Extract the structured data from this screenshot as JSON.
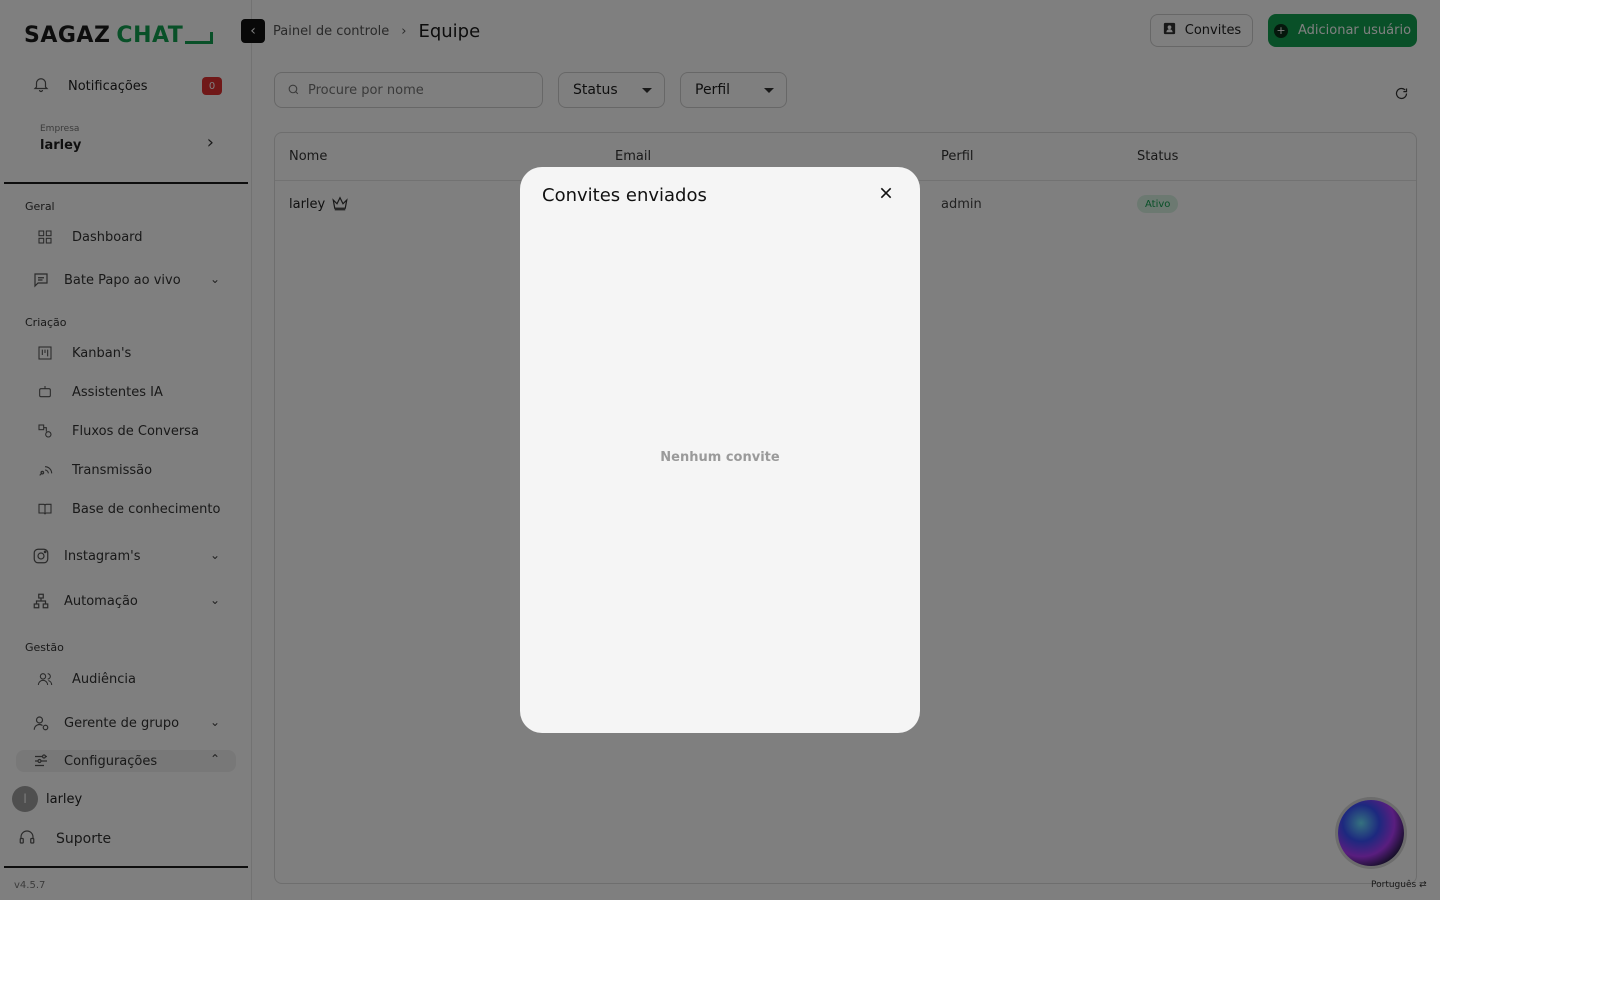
{
  "logo": {
    "part1": "SAGAZ",
    "part2": "CHAT"
  },
  "notifications": {
    "label": "Notificações",
    "count": "0"
  },
  "company": {
    "caption": "Empresa",
    "name": "larley"
  },
  "sections": {
    "general": "Geral",
    "creation": "Criação",
    "management": "Gestão"
  },
  "nav": {
    "dashboard": "Dashboard",
    "livechat": "Bate Papo ao vivo",
    "kanbans": "Kanban's",
    "ai": "Assistentes IA",
    "flows": "Fluxos de Conversa",
    "broadcast": "Transmissão",
    "knowledge": "Base de conhecimento",
    "instagram": "Instagram's",
    "automation": "Automação",
    "audience": "Audiência",
    "groups": "Gerente de grupo",
    "settings": "Configurações"
  },
  "user": {
    "initial": "l",
    "name": "larley"
  },
  "support": "Suporte",
  "version": "v4.5.7",
  "breadcrumb": {
    "parent": "Painel de controle",
    "current": "Equipe"
  },
  "buttons": {
    "invites": "Convites",
    "add_user": "Adicionar usuário"
  },
  "filters": {
    "search_placeholder": "Procure por nome",
    "status": "Status",
    "profile": "Perfil"
  },
  "table": {
    "headers": [
      "Nome",
      "Email",
      "Perfil",
      "Status"
    ],
    "rows": [
      {
        "name": "larley",
        "email": "",
        "profile": "admin",
        "status": "Ativo"
      }
    ]
  },
  "language": "Português",
  "modal": {
    "title": "Convites enviados",
    "empty": "Nenhum convite"
  },
  "colors": {
    "brand_green": "#12a150",
    "badge_red": "#e03131"
  }
}
